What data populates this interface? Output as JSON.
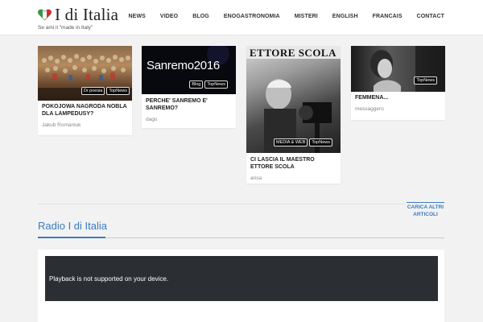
{
  "header": {
    "logo_text": "I di Italia",
    "tagline": "Se ami il \"made in Italy\"",
    "nav": [
      "NEWS",
      "VIDEO",
      "BLOG",
      "ENOGASTRONOMIA",
      "MISTERI",
      "ENGLISH",
      "FRANCAIS",
      "CONTACT"
    ]
  },
  "cards": [
    {
      "title": "POKOJOWA NAGRODA NOBLA DLA LAMPEDUSY?",
      "author": "Jakub Romaniuk",
      "tags": [
        "Dr poesia",
        "TopNews"
      ]
    },
    {
      "title": "PERCHE' SANREMO E' SANREMO?",
      "author": "dago",
      "tags": [
        "Blog",
        "TopNews"
      ],
      "image_text": "Sanremo2016"
    },
    {
      "title": "CI LASCIA IL MAESTRO ETTORE SCOLA",
      "author": "ansa",
      "tags": [
        "MEDIA & WEB",
        "TopNews"
      ],
      "image_text": "ETTORE SCOLA"
    },
    {
      "title": "FEMMENA...",
      "author": "messaggero",
      "tags": [
        "TopNews"
      ]
    }
  ],
  "load_more": {
    "line1": "CARICA ALTRI",
    "line2": "ARTICOLI"
  },
  "radio": {
    "title": "Radio I di Italia",
    "player_message": "Playback is not supported on your device."
  },
  "colors": {
    "accent": "#3a7bbf",
    "player_bg": "#2b2f33"
  }
}
